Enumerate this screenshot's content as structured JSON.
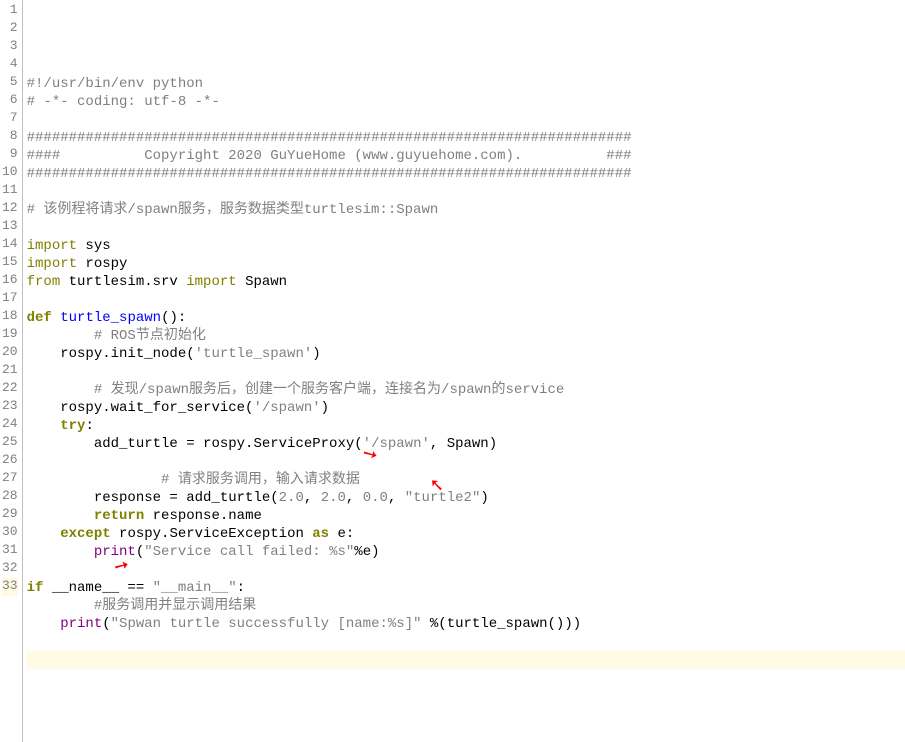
{
  "lines": [
    {
      "num": "1",
      "hl": false,
      "tokens": [
        [
          "comment",
          "#!/usr/bin/env python"
        ]
      ]
    },
    {
      "num": "2",
      "hl": false,
      "tokens": [
        [
          "comment",
          "# -*- coding: utf-8 -*-"
        ]
      ]
    },
    {
      "num": "3",
      "hl": false,
      "tokens": []
    },
    {
      "num": "4",
      "hl": false,
      "tokens": [
        [
          "comment",
          "########################################################################"
        ]
      ]
    },
    {
      "num": "5",
      "hl": false,
      "tokens": [
        [
          "comment",
          "####          Copyright 2020 GuYueHome (www.guyuehome.com).          ###"
        ]
      ]
    },
    {
      "num": "6",
      "hl": false,
      "tokens": [
        [
          "comment",
          "########################################################################"
        ]
      ]
    },
    {
      "num": "7",
      "hl": false,
      "tokens": []
    },
    {
      "num": "8",
      "hl": false,
      "tokens": [
        [
          "comment",
          "# 该例程将请求/spawn服务，服务数据类型turtlesim::Spawn"
        ]
      ]
    },
    {
      "num": "9",
      "hl": false,
      "tokens": []
    },
    {
      "num": "10",
      "hl": false,
      "tokens": [
        [
          "import",
          "import"
        ],
        [
          "name",
          " sys"
        ]
      ]
    },
    {
      "num": "11",
      "hl": false,
      "tokens": [
        [
          "import",
          "import"
        ],
        [
          "name",
          " rospy"
        ]
      ]
    },
    {
      "num": "12",
      "hl": false,
      "tokens": [
        [
          "import",
          "from"
        ],
        [
          "name",
          " turtlesim.srv "
        ],
        [
          "import",
          "import"
        ],
        [
          "name",
          " Spawn"
        ]
      ]
    },
    {
      "num": "13",
      "hl": false,
      "tokens": []
    },
    {
      "num": "14",
      "hl": false,
      "tokens": [
        [
          "def",
          "def"
        ],
        [
          "name",
          " "
        ],
        [
          "funcname",
          "turtle_spawn"
        ],
        [
          "name",
          "():"
        ]
      ]
    },
    {
      "num": "15",
      "hl": false,
      "tokens": [
        [
          "name",
          "        "
        ],
        [
          "comment",
          "# ROS节点初始化"
        ]
      ]
    },
    {
      "num": "16",
      "hl": false,
      "tokens": [
        [
          "name",
          "    rospy.init_node("
        ],
        [
          "string",
          "'turtle_spawn'"
        ],
        [
          "name",
          ")"
        ]
      ]
    },
    {
      "num": "17",
      "hl": false,
      "tokens": []
    },
    {
      "num": "18",
      "hl": false,
      "tokens": [
        [
          "name",
          "        "
        ],
        [
          "comment",
          "# 发现/spawn服务后，创建一个服务客户端，连接名为/spawn的service"
        ]
      ]
    },
    {
      "num": "19",
      "hl": false,
      "tokens": [
        [
          "name",
          "    rospy.wait_for_service("
        ],
        [
          "string",
          "'/spawn'"
        ],
        [
          "name",
          ")"
        ]
      ]
    },
    {
      "num": "20",
      "hl": false,
      "tokens": [
        [
          "name",
          "    "
        ],
        [
          "try",
          "try"
        ],
        [
          "name",
          ":"
        ]
      ]
    },
    {
      "num": "21",
      "hl": false,
      "tokens": [
        [
          "name",
          "        add_turtle = rospy.ServiceProxy("
        ],
        [
          "string",
          "'/spawn'"
        ],
        [
          "name",
          ", Spawn)"
        ]
      ]
    },
    {
      "num": "22",
      "hl": false,
      "tokens": []
    },
    {
      "num": "23",
      "hl": false,
      "tokens": [
        [
          "name",
          "                "
        ],
        [
          "comment",
          "# 请求服务调用，输入请求数据"
        ]
      ]
    },
    {
      "num": "24",
      "hl": false,
      "tokens": [
        [
          "name",
          "        response = add_turtle("
        ],
        [
          "number",
          "2.0"
        ],
        [
          "name",
          ", "
        ],
        [
          "number",
          "2.0"
        ],
        [
          "name",
          ", "
        ],
        [
          "number",
          "0.0"
        ],
        [
          "name",
          ", "
        ],
        [
          "string",
          "\"turtle2\""
        ],
        [
          "name",
          ")"
        ]
      ]
    },
    {
      "num": "25",
      "hl": false,
      "tokens": [
        [
          "name",
          "        "
        ],
        [
          "return",
          "return"
        ],
        [
          "name",
          " response.name"
        ]
      ]
    },
    {
      "num": "26",
      "hl": false,
      "tokens": [
        [
          "name",
          "    "
        ],
        [
          "except",
          "except"
        ],
        [
          "name",
          " rospy.ServiceException "
        ],
        [
          "as",
          "as"
        ],
        [
          "name",
          " e:"
        ]
      ]
    },
    {
      "num": "27",
      "hl": false,
      "tokens": [
        [
          "name",
          "        "
        ],
        [
          "builtin",
          "print"
        ],
        [
          "name",
          "("
        ],
        [
          "string",
          "\"Service call failed: %s\""
        ],
        [
          "name",
          "%e)"
        ]
      ]
    },
    {
      "num": "28",
      "hl": false,
      "tokens": []
    },
    {
      "num": "29",
      "hl": false,
      "tokens": [
        [
          "if",
          "if"
        ],
        [
          "name",
          " __name__ == "
        ],
        [
          "string",
          "\"__main__\""
        ],
        [
          "name",
          ":"
        ]
      ]
    },
    {
      "num": "30",
      "hl": false,
      "tokens": [
        [
          "name",
          "        "
        ],
        [
          "comment",
          "#服务调用并显示调用结果"
        ]
      ]
    },
    {
      "num": "31",
      "hl": false,
      "tokens": [
        [
          "name",
          "    "
        ],
        [
          "builtin",
          "print"
        ],
        [
          "name",
          "("
        ],
        [
          "string",
          "\"Spwan turtle successfully [name:%s]\""
        ],
        [
          "name",
          " %(turtle_spawn()))"
        ]
      ]
    },
    {
      "num": "32",
      "hl": false,
      "tokens": []
    },
    {
      "num": "33",
      "hl": true,
      "tokens": []
    }
  ],
  "annotations": {
    "arrow_glyph": "➘"
  }
}
